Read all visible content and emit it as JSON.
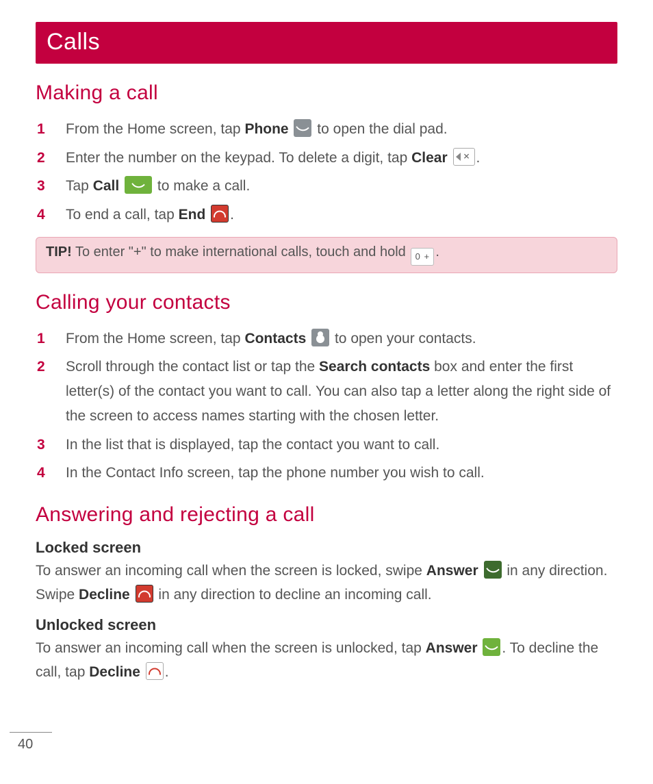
{
  "title": "Calls",
  "page_number": "40",
  "sections": {
    "making": {
      "heading": "Making a call",
      "steps": {
        "s1a": "From the Home screen, tap ",
        "s1b": "Phone",
        "s1c": " to open the dial pad.",
        "s2a": "Enter the number on the keypad. To delete a digit, tap ",
        "s2b": "Clear",
        "s2c": ".",
        "s3a": "Tap ",
        "s3b": "Call",
        "s3c": " to make a call.",
        "s4a": "To end a call, tap ",
        "s4b": "End",
        "s4c": "."
      },
      "tip_label": "TIP!",
      "tip_text": " To enter \"+\" to make international calls, touch and hold ",
      "tip_key": "0 +",
      "tip_end": "."
    },
    "contacts": {
      "heading": "Calling your contacts",
      "steps": {
        "s1a": "From the Home screen, tap ",
        "s1b": "Contacts",
        "s1c": " to open your contacts.",
        "s2a": "Scroll through the contact list or tap the ",
        "s2b": "Search contacts",
        "s2c": " box and enter the first letter(s) of the contact you want to call. You can also tap a letter along the right side of the screen to access names starting with the chosen letter.",
        "s3": "In the list that is displayed, tap the contact you want to call.",
        "s4": "In the Contact Info screen, tap the phone number you wish to call."
      }
    },
    "answer": {
      "heading": "Answering and rejecting a call",
      "locked_h": "Locked screen",
      "locked": {
        "t1": "To answer an incoming call when the screen is locked, swipe ",
        "b1": "Answer",
        "t2": " in any direction. Swipe ",
        "b2": "Decline",
        "t3": " in any direction to decline an incoming call."
      },
      "unlocked_h": "Unlocked screen",
      "unlocked": {
        "t1": "To answer an incoming call when the screen is unlocked, tap ",
        "b1": "Answer",
        "t2": ". To decline the call, tap ",
        "b2": "Decline",
        "t3": "."
      }
    }
  }
}
